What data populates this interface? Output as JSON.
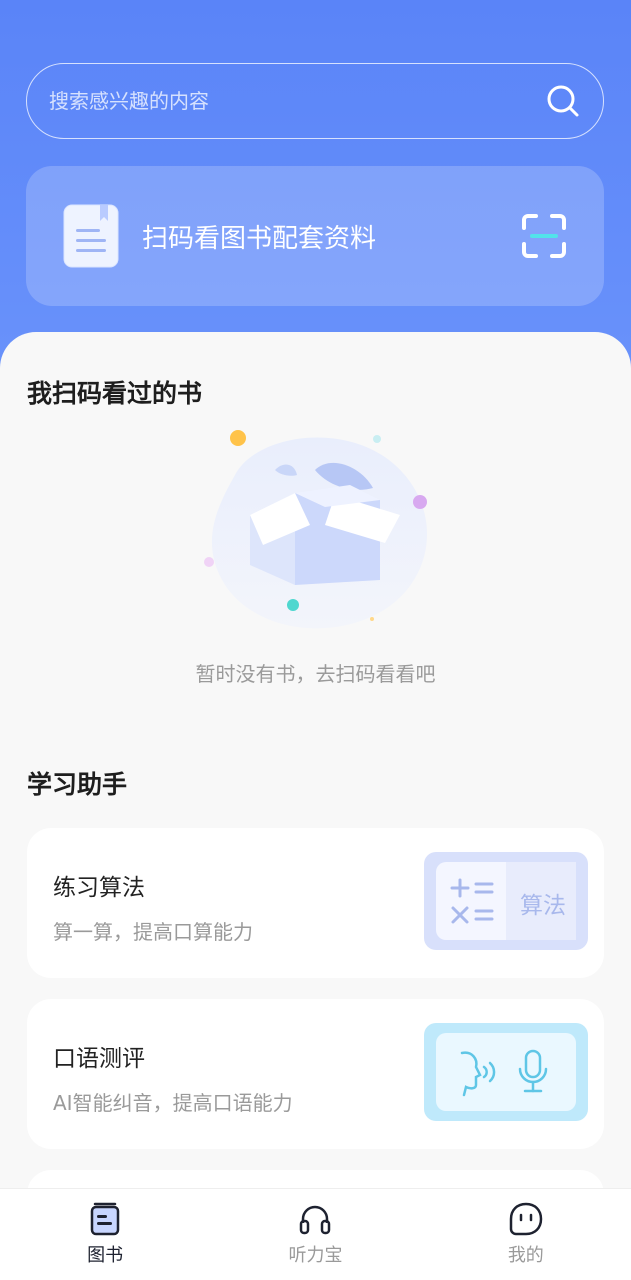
{
  "search": {
    "placeholder": "搜索感兴趣的内容"
  },
  "scan_card": {
    "label": "扫码看图书配套资料"
  },
  "history": {
    "title": "我扫码看过的书",
    "empty_text": "暂时没有书，去扫码看看吧"
  },
  "assistant": {
    "title": "学习助手",
    "tools": [
      {
        "title": "练习算法",
        "subtitle": "算一算，提高口算能力",
        "badge": "算法",
        "icon": "math-symbols-icon"
      },
      {
        "title": "口语测评",
        "subtitle": "AI智能纠音，提高口语能力",
        "icon": "speech-mic-icon"
      }
    ]
  },
  "tabbar": {
    "items": [
      {
        "label": "图书",
        "icon": "book-icon",
        "active": true
      },
      {
        "label": "听力宝",
        "icon": "headphones-icon",
        "active": false
      },
      {
        "label": "我的",
        "icon": "face-icon",
        "active": false
      }
    ]
  },
  "colors": {
    "header_blue": "#5a84f8",
    "accent_teal": "#52e3ea",
    "text_dark": "#1e1e1e",
    "text_muted": "#9a9a9a"
  }
}
